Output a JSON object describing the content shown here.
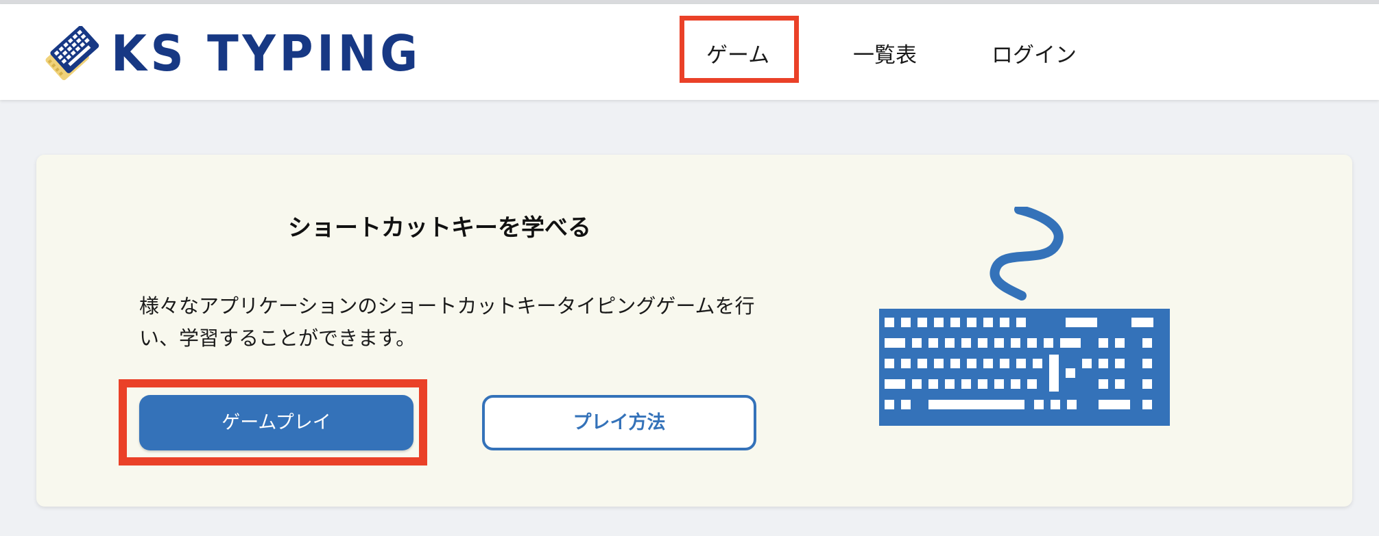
{
  "header": {
    "logo_text": "KS TYPING",
    "nav": {
      "game": "ゲーム",
      "list": "一覧表",
      "login": "ログイン"
    }
  },
  "hero": {
    "title": "ショートカットキーを学べる",
    "description": "様々なアプリケーションのショートカットキータイピングゲームを行い、学習することができます。",
    "play_button": "ゲームプレイ",
    "howto_button": "プレイ方法"
  },
  "colors": {
    "brand_navy": "#173884",
    "accent_blue": "#3472b9",
    "highlight_red": "#ea4128",
    "card_bg": "#f8f8ee",
    "page_bg": "#eff1f4"
  },
  "icons": [
    "keyboard-logo-icon",
    "keyboard-illustration-icon"
  ]
}
